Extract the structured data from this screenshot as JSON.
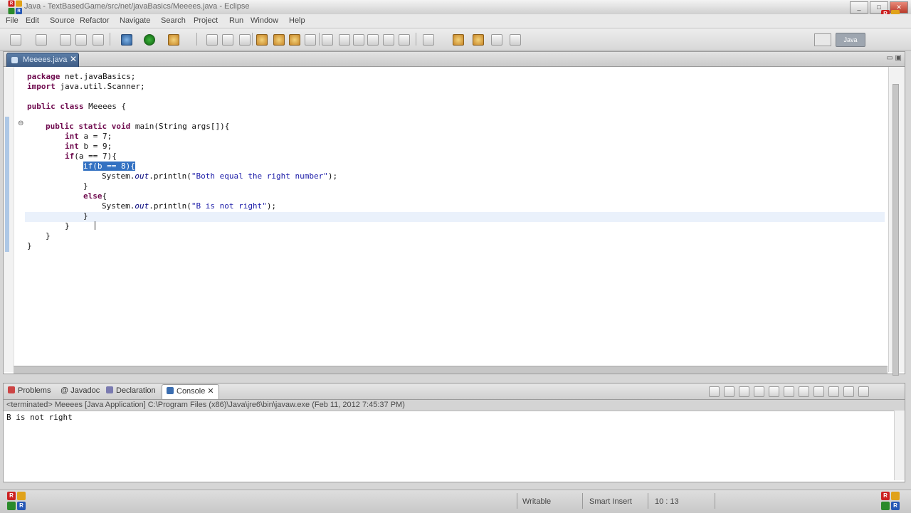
{
  "window": {
    "title": "Java - TextBasedGame/src/net/javaBasics/Meeees.java - Eclipse",
    "controls": [
      "_",
      "□",
      "✕"
    ]
  },
  "menubar": {
    "items": [
      "File",
      "Edit",
      "Source",
      "Refactor",
      "Navigate",
      "Search",
      "Project",
      "Run",
      "Window",
      "Help"
    ]
  },
  "toolbar": {
    "perspective_label": "Java"
  },
  "editor": {
    "tab_label": "Meeees.java",
    "tab_close": "✕",
    "fold_marker": "⊖",
    "code_lines": {
      "l1_kw": "package",
      "l1_rest": " net.javaBasics;",
      "l2_kw": "import",
      "l2_rest": " java.util.Scanner;",
      "l4_kw1": "public",
      "l4_kw2": "class",
      "l4_rest": " Meeees {",
      "l6_kw1": "public",
      "l6_kw2": "static",
      "l6_kw3": "void",
      "l6_rest": " main(String args[]){",
      "l7_kw": "int",
      "l7_rest": " a = 7;",
      "l8_kw": "int",
      "l8_rest": " b = 9;",
      "l9_kw": "if",
      "l9_rest": "(a == 7){",
      "l10_sel": "if(b == 8){",
      "l11_pre": "System.",
      "l11_it": "out",
      "l11_mid": ".println(",
      "l11_str": "\"Both equal the right number\"",
      "l11_end": ");",
      "l12": "}",
      "l13_kw": "else",
      "l13_rest": "{",
      "l14_pre": "System.",
      "l14_it": "out",
      "l14_mid": ".println(",
      "l14_str": "\"B is not right\"",
      "l14_end": ");",
      "l15": "}",
      "l16": "}",
      "l17": "}",
      "l18": "}"
    }
  },
  "bottom_panel": {
    "tabs": [
      {
        "label": "Problems",
        "icon": "problems-icon"
      },
      {
        "label": "@ Javadoc",
        "icon": "javadoc-icon"
      },
      {
        "label": "Declaration",
        "icon": "declaration-icon"
      },
      {
        "label": "Console",
        "icon": "console-icon",
        "active": true
      }
    ],
    "console_close": "✕",
    "console_header": "<terminated> Meeees [Java Application] C:\\Program Files (x86)\\Java\\jre6\\bin\\javaw.exe (Feb 11, 2012 7:45:37 PM)",
    "console_output": "B is not right"
  },
  "statusbar": {
    "writable": "Writable",
    "insert_mode": "Smart Insert",
    "position": "10 : 13"
  },
  "colors": {
    "keyword": "#6f0a4e",
    "string": "#1b1ba8",
    "selection": "#3371c2"
  }
}
